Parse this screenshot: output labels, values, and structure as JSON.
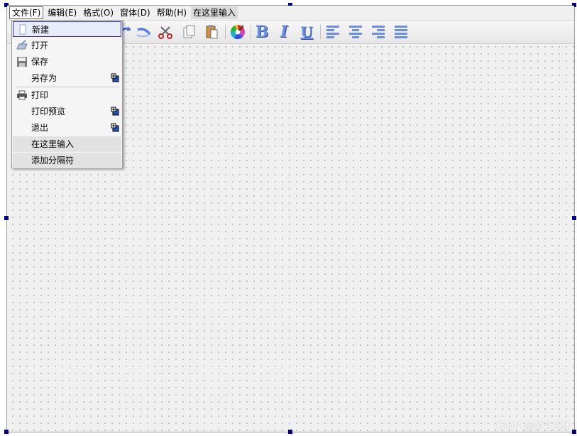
{
  "menubar": {
    "items": [
      {
        "label": "文件(F)"
      },
      {
        "label": "编辑(E)"
      },
      {
        "label": "格式(O)"
      },
      {
        "label": "窗体(D)"
      },
      {
        "label": "帮助(H)"
      },
      {
        "label": "在这里输入"
      }
    ]
  },
  "file_menu": {
    "items": [
      {
        "label": "新建",
        "icon": "new-file-icon"
      },
      {
        "label": "打开",
        "icon": "open-folder-icon"
      },
      {
        "label": "保存",
        "icon": "save-icon"
      },
      {
        "label": "另存为",
        "icon": ""
      },
      {
        "label": "打印",
        "icon": "printer-icon"
      },
      {
        "label": "打印预览",
        "icon": ""
      },
      {
        "label": "退出",
        "icon": ""
      },
      {
        "label": "在这里输入",
        "icon": ""
      },
      {
        "label": "添加分隔符",
        "icon": ""
      }
    ]
  },
  "toolbar": {
    "icons": [
      "redo-icon",
      "undo-icon",
      "cut-icon",
      "copy-icon",
      "paste-icon",
      "color-icon",
      "bold-icon",
      "italic-icon",
      "underline-icon",
      "align-left-icon",
      "align-center-icon",
      "align-right-icon",
      "justify-icon"
    ],
    "bold_glyph": "B",
    "italic_glyph": "I",
    "underline_glyph": "U"
  },
  "watermark": "CSDN @国中之林",
  "colors": {
    "highlight_border": "#3030c0",
    "handle": "#000080",
    "icon_blue": "#5a7fd8"
  }
}
